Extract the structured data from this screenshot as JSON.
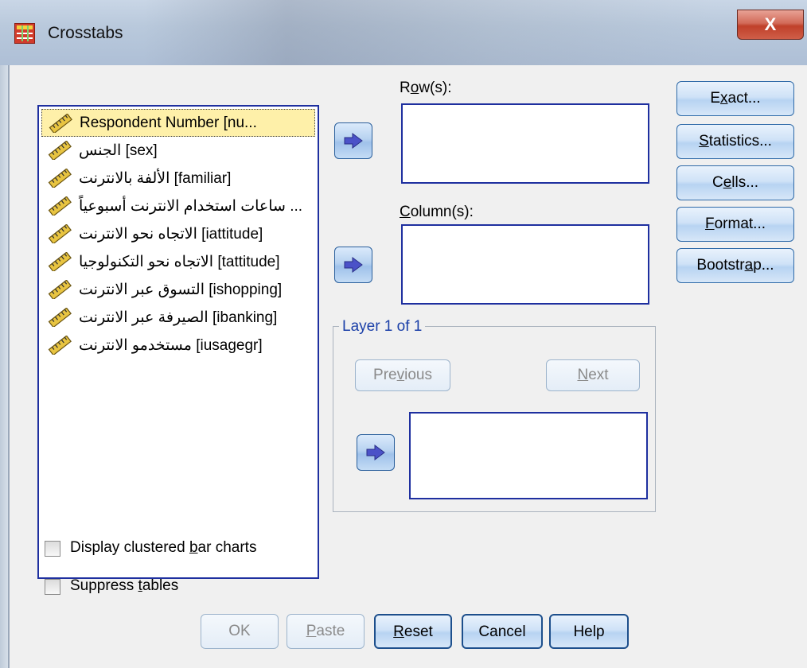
{
  "window": {
    "title": "Crosstabs",
    "close_label": "X"
  },
  "variables": [
    {
      "label": "Respondent Number [nu...",
      "selected": true
    },
    {
      "label": "الجنس [sex]"
    },
    {
      "label": "الألفة بالانترنت [familiar]"
    },
    {
      "label": "ساعات استخدام الانترنت أسبوعياً ..."
    },
    {
      "label": "الاتجاه نحو الانترنت [iattitude]"
    },
    {
      "label": "الاتجاه نحو التكنولوجيا [tattitude]"
    },
    {
      "label": "التسوق عبر الانترنت [ishopping]"
    },
    {
      "label": "الصيرفة عبر الانترنت [ibanking]"
    },
    {
      "label": "مستخدمو الانترنت [iusagegr]"
    }
  ],
  "rows": {
    "label_a": "R",
    "label_u": "o",
    "label_b": "w(s):"
  },
  "columns": {
    "label_u": "C",
    "label_b": "olumn(s):"
  },
  "layer": {
    "title": "Layer 1 of 1",
    "previous_a": "Pre",
    "previous_u": "v",
    "previous_b": "ious",
    "next_u": "N",
    "next_b": "ext"
  },
  "side_buttons": {
    "exact_a": "E",
    "exact_u": "x",
    "exact_b": "act...",
    "statistics_u": "S",
    "statistics_b": "tatistics...",
    "cells_a": "C",
    "cells_u": "e",
    "cells_b": "lls...",
    "format_u": "F",
    "format_b": "ormat...",
    "bootstrap_a": "Bootstr",
    "bootstrap_u": "a",
    "bootstrap_b": "p..."
  },
  "options": {
    "clustered_a": "Display clustered ",
    "clustered_u": "b",
    "clustered_b": "ar charts",
    "suppress_a": "Suppress ",
    "suppress_u": "t",
    "suppress_b": "ables"
  },
  "bottom_buttons": {
    "ok": "OK",
    "paste_u": "P",
    "paste_b": "aste",
    "reset_u": "R",
    "reset_b": "eset",
    "cancel": "Cancel",
    "help": "Help"
  },
  "icons": {
    "variable": "ruler-icon",
    "move": "arrow-right-icon",
    "app": "crosstabs-table-icon"
  }
}
